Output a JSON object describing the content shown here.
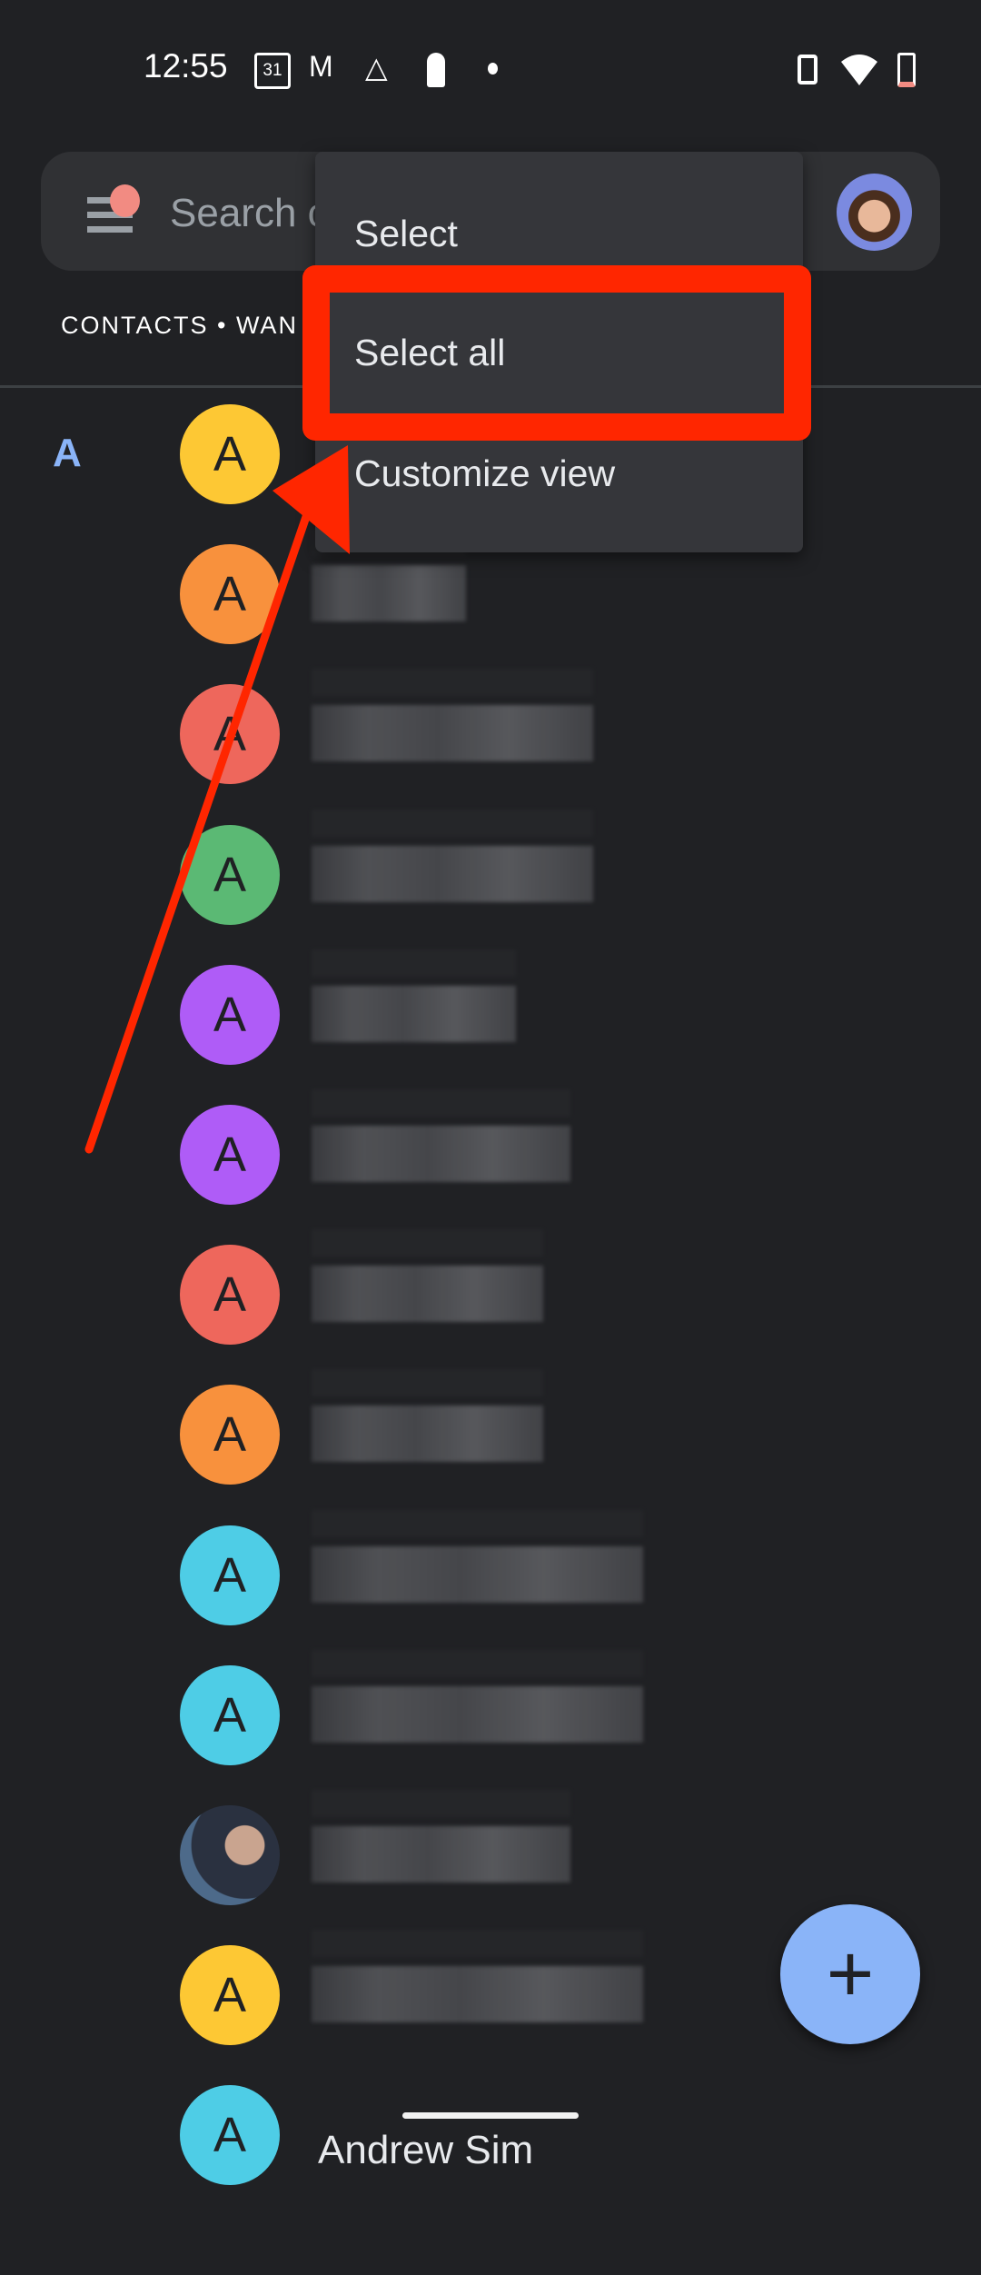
{
  "status_bar": {
    "time": "12:55",
    "icons": [
      "calendar-31-icon",
      "gmail-icon",
      "drive-icon",
      "keyhole-icon",
      "dot-icon",
      "vibrate-icon",
      "wifi-icon",
      "battery-low-icon"
    ],
    "calendar_day": "31"
  },
  "search": {
    "placeholder": "Search c",
    "notification_color": "#f28b82"
  },
  "tab_label": "CONTACTS • WAN",
  "section_letter": "A",
  "menu": {
    "items": [
      {
        "label": "Select"
      },
      {
        "label": "Select all"
      },
      {
        "label": "Customize view"
      }
    ],
    "highlighted": "Select all",
    "highlight_color": "#ff2600"
  },
  "contacts": [
    {
      "initial": "A",
      "color": "#fdc834"
    },
    {
      "initial": "A",
      "color": "#f8913d"
    },
    {
      "initial": "A",
      "color": "#ee675c"
    },
    {
      "initial": "A",
      "color": "#5bb974"
    },
    {
      "initial": "A",
      "color": "#af5cf7"
    },
    {
      "initial": "A",
      "color": "#af5cf7"
    },
    {
      "initial": "A",
      "color": "#ee675c"
    },
    {
      "initial": "A",
      "color": "#f8913d"
    },
    {
      "initial": "A",
      "color": "#4ecde6"
    },
    {
      "initial": "A",
      "color": "#4ecde6"
    },
    {
      "initial": "",
      "color": "photo"
    },
    {
      "initial": "A",
      "color": "#fdc834"
    },
    {
      "initial": "A",
      "color": "#4ecde6",
      "name": "Andrew Sim"
    }
  ],
  "fab": {
    "icon": "plus-icon",
    "label": "+",
    "color": "#8ab4f8"
  },
  "annotation": {
    "type": "arrow",
    "color": "#ff2600"
  }
}
